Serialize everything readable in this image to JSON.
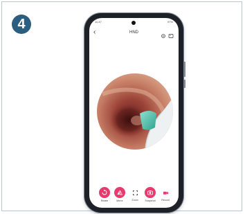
{
  "step_number": "4",
  "phone": {
    "status_time": "11:47",
    "status_right": "97%",
    "nav_title": "HND",
    "back_symbol": "‹"
  },
  "toolbar": {
    "items": [
      {
        "label": "Rotate",
        "icon": "rotate-icon"
      },
      {
        "label": "Mirror",
        "icon": "mirror-icon"
      },
      {
        "label": "Zoom",
        "icon": "zoom-icon"
      },
      {
        "label": "Snapshot",
        "icon": "camera-icon"
      },
      {
        "label": "Record",
        "icon": "video-icon"
      }
    ]
  },
  "colors": {
    "badge": "#2c5f7f",
    "accent": "#e63b6f",
    "phone_body": "#1f2128"
  }
}
